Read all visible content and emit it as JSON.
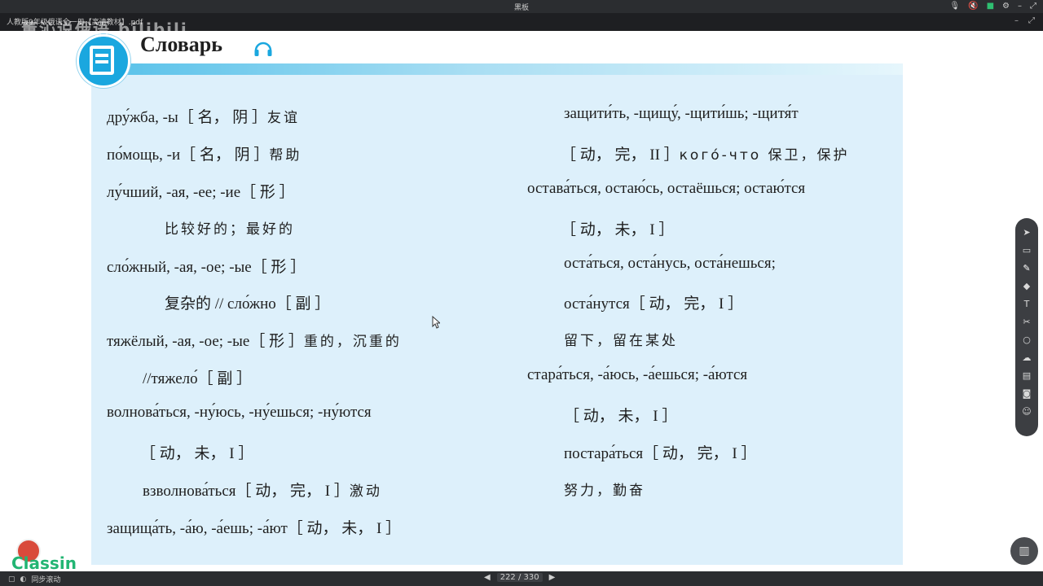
{
  "window": {
    "title": "黑板",
    "file_name": "人教版9年级俄语全一册【高清教材】.pdf",
    "watermark": "董沁说俄语 bilibili"
  },
  "header": {
    "title": "Словарь"
  },
  "left_column": [
    {
      "ru": "дру́жба, -ы",
      "bracket": "［ 名， 阴 ］",
      "cn": "友谊"
    },
    {
      "ru": "по́мощь, -и",
      "bracket": "［ 名， 阴 ］",
      "cn": "帮助"
    },
    {
      "ru": "лу́чший, -ая, -ее; -ие",
      "bracket": "［ 形 ］",
      "cn": ""
    },
    {
      "ru": "",
      "bracket": "",
      "cn": "比较好的；最好的"
    },
    {
      "ru": "сло́жный, -ая, -ое; -ые",
      "bracket": "［ 形 ］",
      "cn": ""
    },
    {
      "ru": "复杂的 // сло́жно",
      "bracket": "［ 副 ］",
      "cn": ""
    },
    {
      "ru": "тяжёлый, -ая, -ое; -ые",
      "bracket": "［ 形 ］",
      "cn": "重的，沉重的"
    },
    {
      "ru": "//тяжело́",
      "bracket": "［ 副 ］",
      "cn": ""
    },
    {
      "ru": "волнова́ться, -ну́юсь, -ну́ешься; -ну́ются",
      "bracket": "",
      "cn": ""
    },
    {
      "ru": "",
      "bracket": "［ 动， 未， I ］",
      "cn": ""
    },
    {
      "ru": "взволнова́ться",
      "bracket": "［ 动， 完， I ］",
      "cn": "激动"
    },
    {
      "ru": "защища́ть, -а́ю, -а́ешь; -а́ют",
      "bracket": "［ 动， 未， I ］",
      "cn": ""
    }
  ],
  "right_column": [
    {
      "ru": "защити́ть, -щищу́, -щити́шь; -щитя́т",
      "bracket": "",
      "cn": ""
    },
    {
      "ru": "",
      "bracket": "［ 动， 完， II ］",
      "cn": "кого́-что 保卫，保护"
    },
    {
      "ru": "остава́ться, остаю́сь, остаёшься; остаю́тся",
      "bracket": "",
      "cn": ""
    },
    {
      "ru": "",
      "bracket": "［ 动， 未， I ］",
      "cn": ""
    },
    {
      "ru": "оста́ться, оста́нусь, оста́нешься;",
      "bracket": "",
      "cn": ""
    },
    {
      "ru": "оста́нутся",
      "bracket": "［ 动， 完， I ］",
      "cn": ""
    },
    {
      "ru": "",
      "bracket": "",
      "cn": "留下，留在某处"
    },
    {
      "ru": "стара́ться, -а́юсь, -а́ешься; -а́ются",
      "bracket": "",
      "cn": ""
    },
    {
      "ru": "",
      "bracket": "［ 动， 未， I ］",
      "cn": ""
    },
    {
      "ru": "постара́ться",
      "bracket": "［ 动， 完， I ］",
      "cn": ""
    },
    {
      "ru": "",
      "bracket": "",
      "cn": "努力，勤奋"
    }
  ],
  "toolbar_icons": [
    "pointer-icon",
    "select-icon",
    "pen-icon",
    "eraser-icon",
    "text-icon",
    "scissors-icon",
    "shape-icon",
    "cloud-icon",
    "folder-icon",
    "camera-icon",
    "users-icon"
  ],
  "brand": {
    "name": "Classin"
  },
  "bottom_bar": {
    "sync_label": "同步滚动",
    "page_current": "222",
    "page_total": "330",
    "page_label": "222 / 330"
  }
}
